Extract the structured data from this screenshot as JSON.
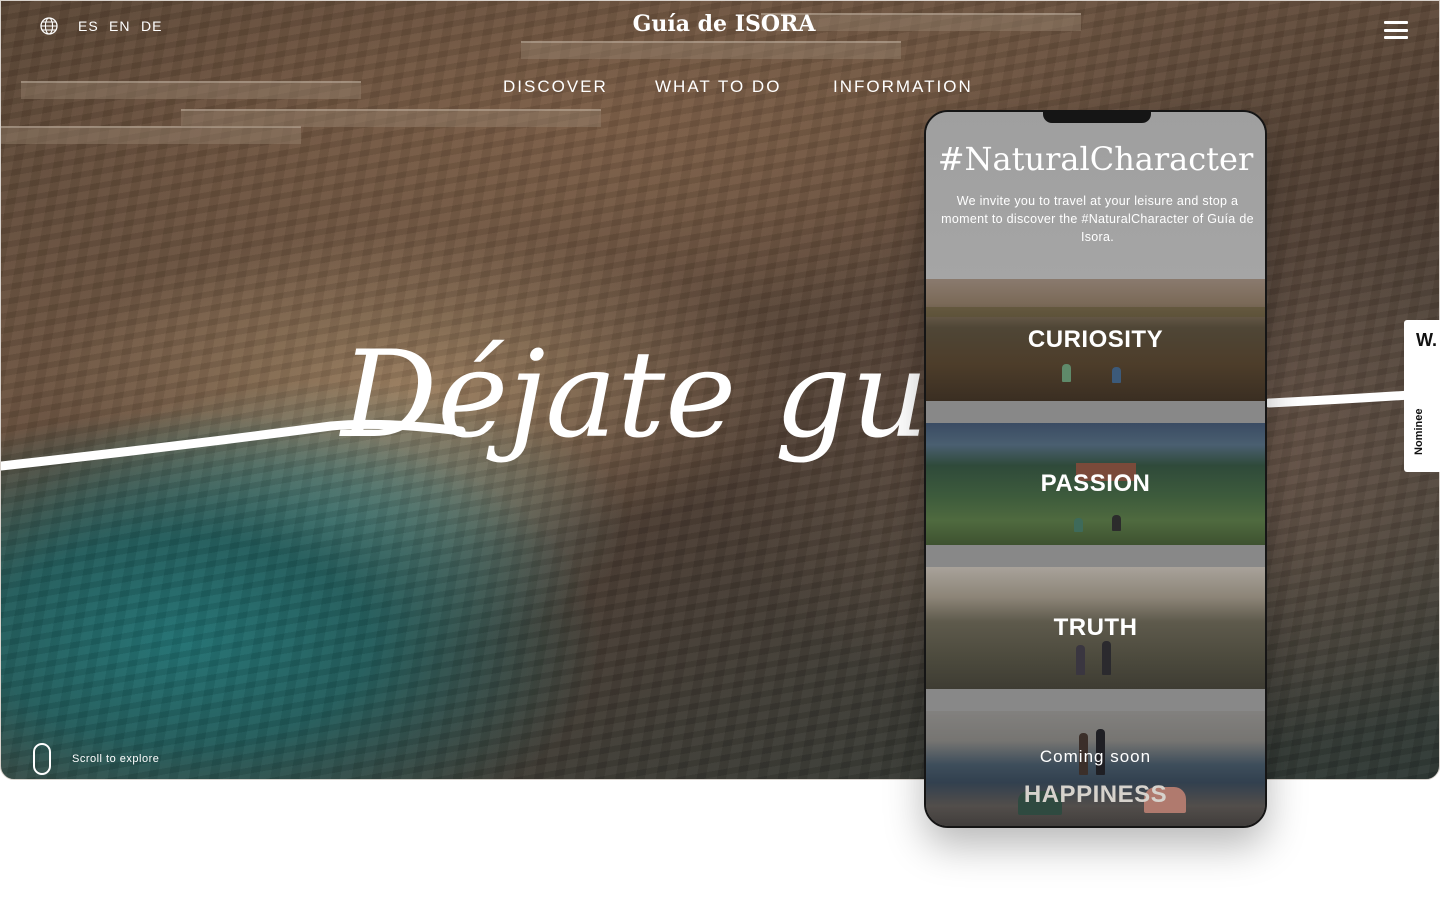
{
  "header": {
    "brand": "Guía de ISORA",
    "languages": [
      "ES",
      "EN",
      "DE"
    ],
    "menu_icon": "hamburger-icon",
    "language_icon": "globe-icon"
  },
  "nav": {
    "items": [
      {
        "label": "DISCOVER"
      },
      {
        "label": "WHAT TO DO"
      },
      {
        "label": "INFORMATION"
      }
    ]
  },
  "hero": {
    "script_text": "Déjate guiar",
    "scroll_label": "Scroll to explore",
    "scroll_icon": "mouse-icon"
  },
  "award": {
    "logo": "W.",
    "label": "Nominee"
  },
  "phone": {
    "title": "#NaturalCharacter",
    "intro": "We invite you to travel at your leisure and stop a moment to discover the #NaturalCharacter of Guía de Isora.",
    "cards": [
      {
        "label": "CURIOSITY"
      },
      {
        "label": "PASSION"
      },
      {
        "label": "TRUTH"
      },
      {
        "label": "HAPPINESS",
        "note": "Coming soon"
      }
    ]
  },
  "colors": {
    "overlay_text": "#ffffff",
    "phone_header": "#a3a3a3",
    "phone_frame": "#151515"
  }
}
